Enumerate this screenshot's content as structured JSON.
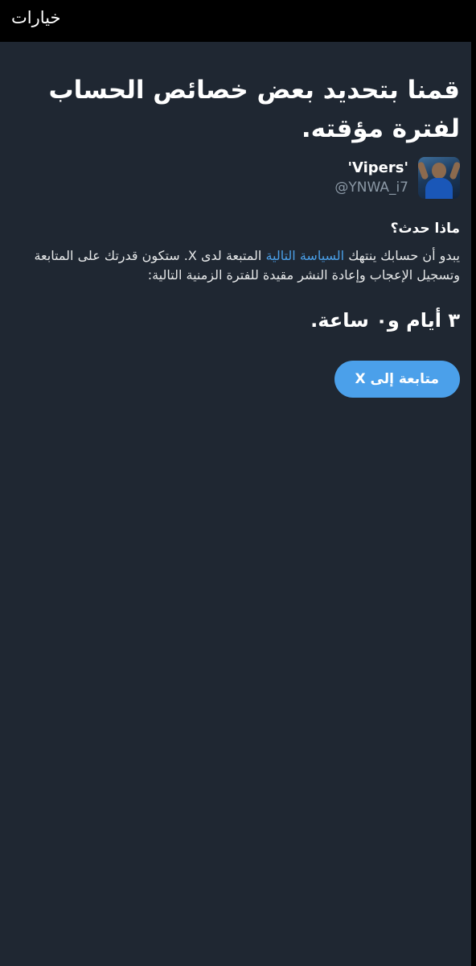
{
  "header": {
    "title": "خيارات"
  },
  "main": {
    "title": "قمنا بتحديد بعض خصائص الحساب لفترة مؤقته.",
    "account": {
      "display_name": "'Vipers'",
      "handle": "@YNWA_i7"
    },
    "what_happened": "ماذا حدث؟",
    "body": {
      "before_link": "يبدو أن حسابك ينتهك ",
      "link": "السياسة التالية",
      "after_link": " المتبعة لدى X. ستكون قدرتك على المتابعة وتسجيل الإعجاب وإعادة النشر مقيدة للفترة الزمنية التالية:"
    },
    "duration": "٣ أيام و٠ ساعة.",
    "continue_button": "متابعة إلى X"
  },
  "colors": {
    "background": "#1f2732",
    "link": "#4a9fe8",
    "button": "#4ba0ea",
    "secondary_text": "#8b98a5"
  }
}
